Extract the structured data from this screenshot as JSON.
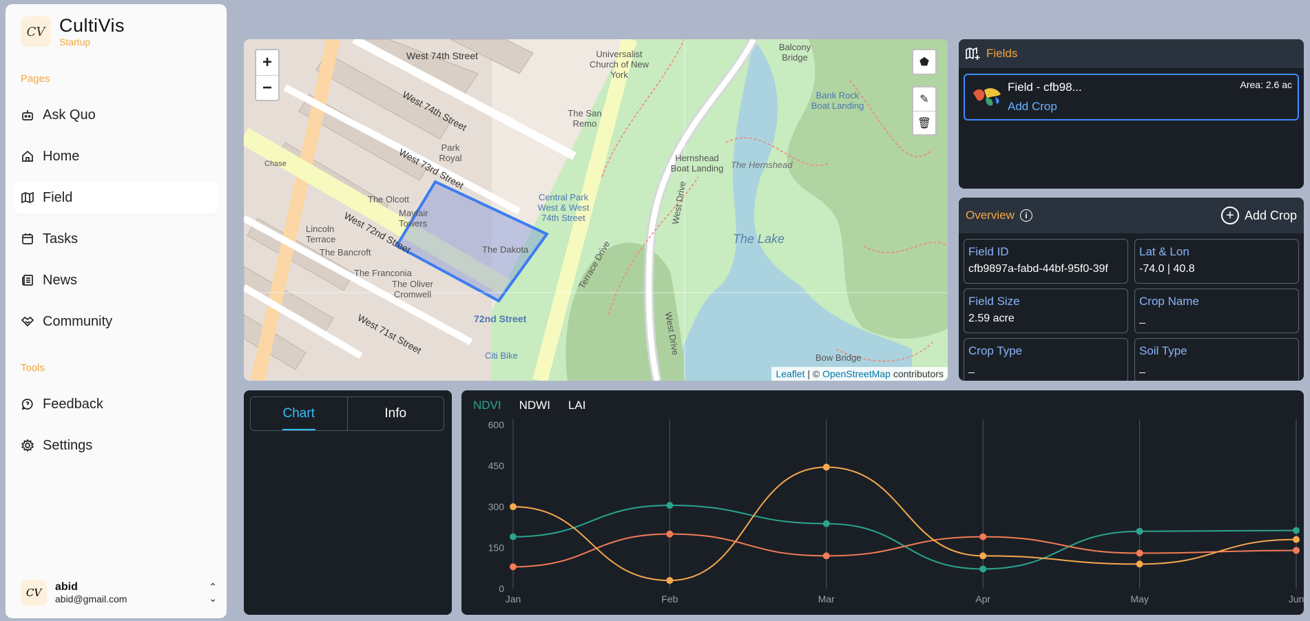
{
  "app": {
    "name": "CultiVis",
    "plan": "Startup",
    "logo_text": "CV"
  },
  "sidebar": {
    "pages_label": "Pages",
    "tools_label": "Tools",
    "items": [
      {
        "label": "Ask Quo",
        "icon": "robot-icon"
      },
      {
        "label": "Home",
        "icon": "home-icon"
      },
      {
        "label": "Field",
        "icon": "map-icon",
        "active": true
      },
      {
        "label": "Tasks",
        "icon": "calendar-icon"
      },
      {
        "label": "News",
        "icon": "newspaper-icon"
      },
      {
        "label": "Community",
        "icon": "handshake-icon"
      }
    ],
    "tools": [
      {
        "label": "Feedback",
        "icon": "feedback-icon"
      },
      {
        "label": "Settings",
        "icon": "gear-icon"
      }
    ]
  },
  "user": {
    "name": "abid",
    "email": "abid@gmail.com"
  },
  "map": {
    "zoom_in": "+",
    "zoom_out": "−",
    "attribution": {
      "leaflet": "Leaflet",
      "sep": " | © ",
      "osm": "OpenStreetMap",
      "tail": " contributors"
    },
    "labels": {
      "w74": "West 74th Street",
      "w73": "West 73rd Street",
      "w72": "West 72nd Street",
      "w71": "West 71st Street",
      "park_royal": "Park Royal",
      "olcott": "The Olcott",
      "mayfair": "Mayfair Towers",
      "dakota": "The Dakota",
      "lincoln": "Lincoln Terrace",
      "bancroft": "The Bancroft",
      "franconia": "The Franconia",
      "oliver": "The Oliver Cromwell",
      "san_remo": "The San Remo",
      "universalist": "Universalist Church of New York",
      "cpw": "Central Park West & West 74th Street",
      "st72": "72nd Street",
      "citibike": "Citi Bike",
      "hernshead_boat": "Hernshead Boat Landing",
      "hernshead": "The Hernshead",
      "lake": "The Lake",
      "bankrock": "Bank Rock Boat Landing",
      "balcony": "Balcony Bridge",
      "west_drive": "West Drive",
      "terrace_drive": "Terrace Drive",
      "bow": "Bow Bridge",
      "chase": "Chase"
    }
  },
  "fields": {
    "title": "Fields",
    "items": [
      {
        "name": "Field - cfb98...",
        "action": "Add Crop",
        "area": "Area: 2.6 ac"
      }
    ]
  },
  "overview": {
    "title": "Overview",
    "add_label": "Add Crop",
    "cards": [
      {
        "label": "Field ID",
        "value": "cfb9897a-fabd-44bf-95f0-39f"
      },
      {
        "label": "Lat & Lon",
        "value": "-74.0 | 40.8"
      },
      {
        "label": "Field Size",
        "value": "2.59 acre"
      },
      {
        "label": "Crop Name",
        "value": "_"
      },
      {
        "label": "Crop Type",
        "value": "_"
      },
      {
        "label": "Soil Type",
        "value": "_"
      }
    ]
  },
  "left_tabs": [
    {
      "label": "Chart",
      "active": true
    },
    {
      "label": "Info"
    }
  ],
  "chart_tabs": [
    {
      "label": "NDVI",
      "active": true
    },
    {
      "label": "NDWI"
    },
    {
      "label": "LAI"
    }
  ],
  "chart_data": {
    "type": "line",
    "categories": [
      "Jan",
      "Feb",
      "Mar",
      "Apr",
      "May",
      "Jun"
    ],
    "ylim": [
      0,
      600
    ],
    "yticks": [
      0,
      150,
      300,
      450,
      600
    ],
    "series": [
      {
        "color": "#2aa58f",
        "values": [
          190,
          305,
          238,
          72,
          210,
          213
        ]
      },
      {
        "color": "#f47c55",
        "values": [
          80,
          200,
          120,
          190,
          130,
          140
        ]
      },
      {
        "color": "#f7a94d",
        "values": [
          300,
          30,
          445,
          120,
          90,
          180
        ]
      }
    ]
  }
}
